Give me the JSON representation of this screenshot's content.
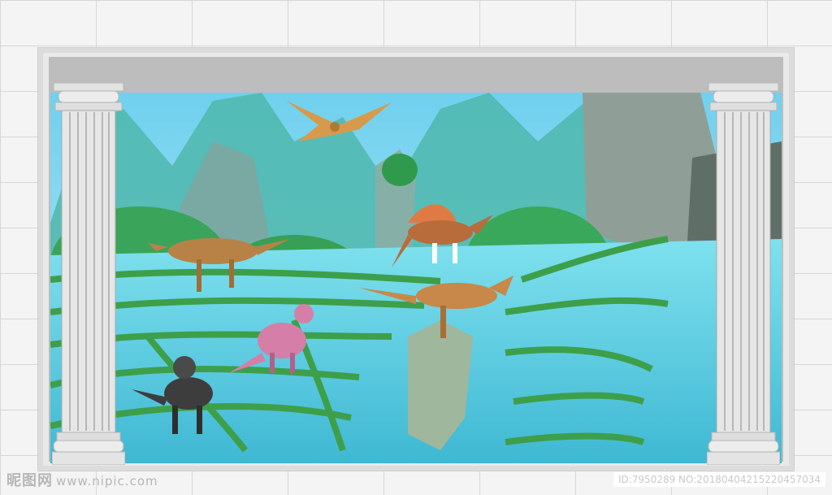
{
  "watermark": {
    "brand": "昵图网",
    "url": "www.nipic.com"
  },
  "image_id_line": "ID:7950289 NO:20180404215220457034",
  "colors": {
    "sky": "#7ad3ec",
    "water": "#6fd6e8",
    "grass": "#3ea655",
    "rock": "#8aa7a0",
    "frame": "#e9e9e9"
  }
}
